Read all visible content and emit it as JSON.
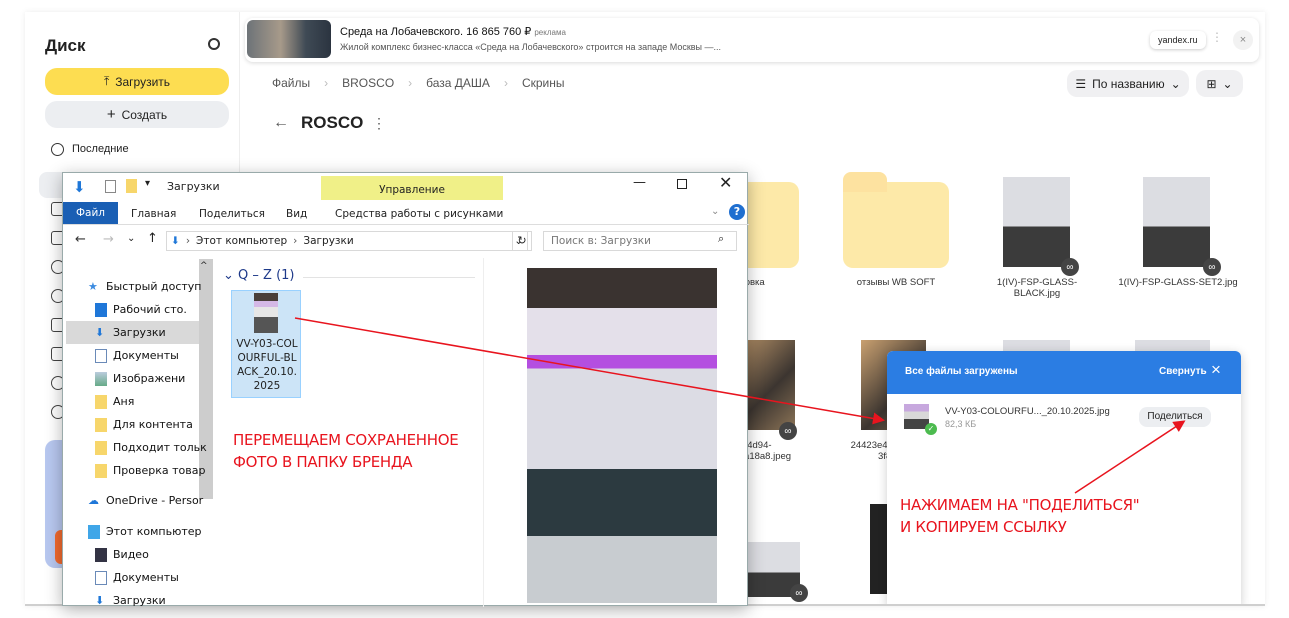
{
  "sidebar": {
    "title": "Диск",
    "upload": "Загрузить",
    "create": "Создать",
    "recent": "Последние"
  },
  "ad": {
    "title": "Среда на Лобачевского. 16 865 760 ₽",
    "tag": "реклама",
    "subtitle": "Жилой комплекс бизнес-класса «Среда на Лобачевского» строится на западе Москвы —...",
    "domain": "yandex.ru"
  },
  "breadcrumb": [
    "Файлы",
    "BROSCO",
    "база ДАША",
    "Скрины"
  ],
  "folder_title": "ROSCO",
  "sort": {
    "label": "По названию"
  },
  "grid": {
    "row1": [
      "упаковка",
      "отзывы WB SOFT",
      "1(IV)-FSP-GLASS-BLACK.jpg",
      "1(IV)-FSP-GLASS-SET2.jpg"
    ],
    "row2": [
      "...0958-4d94-ad...8ea18a8.jpeg",
      "24423e42-...7f-3f80e5..."
    ]
  },
  "explorer": {
    "title": "Загрузки",
    "manage": "Управление",
    "tabs": [
      "Файл",
      "Главная",
      "Поделиться",
      "Вид"
    ],
    "picture_tools": "Средства работы с рисунками",
    "path": [
      "Этот компьютер",
      "Загрузки"
    ],
    "search_placeholder": "Поиск в: Загрузки",
    "nav": [
      "Быстрый доступ",
      "Рабочий сто.",
      "Загрузки",
      "Документы",
      "Изображени",
      "Аня",
      "Для контента",
      "Подходит тольк",
      "Проверка товар",
      "OneDrive - Persor",
      "Этот компьютер",
      "Видео",
      "Документы",
      "Загрузки"
    ],
    "group": "Q – Z (1)",
    "file": "VV-Y03-COLOURFUL-BLACK_20.10.2025"
  },
  "upload": {
    "title": "Все файлы загружены",
    "collapse": "Свернуть",
    "file": "VV-Y03-COLOURFU..._20.10.2025.jpg",
    "size": "82,3 КБ",
    "share": "Поделиться"
  },
  "annotations": {
    "left": [
      "ПЕРЕМЕЩАЕМ СОХРАНЕННОЕ",
      "ФОТО В ПАПКУ БРЕНДА"
    ],
    "right": [
      "НАЖИМАЕМ НА \"ПОДЕЛИТЬСЯ\"",
      "И КОПИРУЕМ ССЫЛКУ"
    ]
  },
  "colors": {
    "upload_btn": "#fddd51",
    "panel_header": "#2b7de3",
    "annotation": "#e8141e",
    "explorer_file_tab": "#1a5fb4"
  }
}
